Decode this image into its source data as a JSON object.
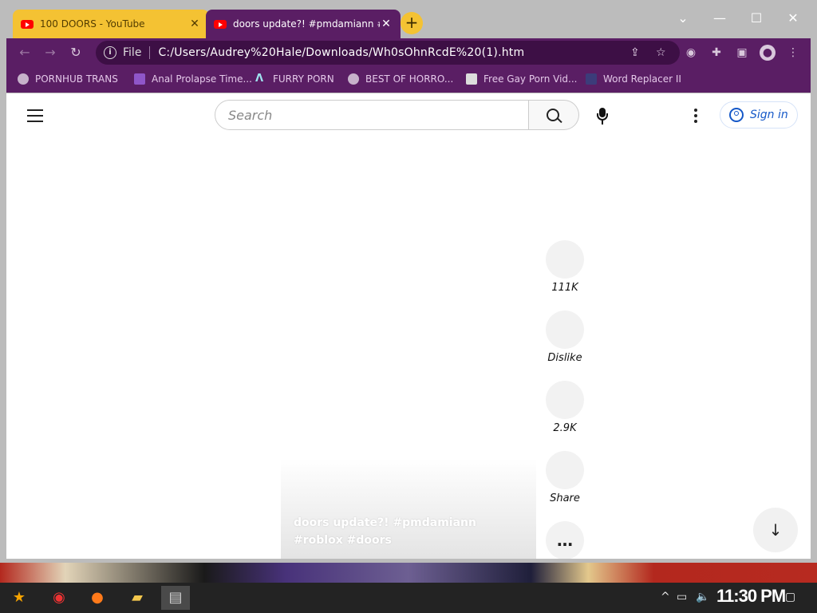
{
  "tabs": [
    {
      "title": "100 DOORS - YouTube",
      "active": false
    },
    {
      "title": "doors update?! #pmdamiann #r",
      "active": true
    }
  ],
  "new_tab_label": "+",
  "window_controls": {
    "chevron": "⌄",
    "minimize": "—",
    "maximize": "☐",
    "close": "✕"
  },
  "omnibox": {
    "scheme": "File",
    "url": "C:/Users/Audrey%20Hale/Downloads/Wh0sOhnRcdE%20(1).htm"
  },
  "bookmarks": [
    {
      "label": "PORNHUB TRANS",
      "icon": "globe-icon"
    },
    {
      "label": "Anal Prolapse Time...",
      "icon": "bookmark-icon"
    },
    {
      "label": "FURRY PORN",
      "icon": "lambda-icon"
    },
    {
      "label": "BEST OF HORRO...",
      "icon": "globe-icon"
    },
    {
      "label": "Free Gay Porn Vid...",
      "icon": "site-icon"
    },
    {
      "label": "Word Replacer II",
      "icon": "extension-icon"
    }
  ],
  "youtube": {
    "search_placeholder": "Search",
    "signin_label": "Sign in",
    "video_caption": "doors update?! #pmdamiann #roblox #doors",
    "actions": [
      {
        "name": "like",
        "label": "111K"
      },
      {
        "name": "dislike",
        "label": "Dislike"
      },
      {
        "name": "comments",
        "label": "2.9K"
      },
      {
        "name": "share",
        "label": "Share"
      },
      {
        "name": "more",
        "label": "…"
      }
    ]
  },
  "taskbar": {
    "time": "11:30 PM"
  },
  "colors": {
    "accent_purple": "#5a1e64",
    "tab_yellow": "#f4c233",
    "link_blue": "#1558c8"
  }
}
